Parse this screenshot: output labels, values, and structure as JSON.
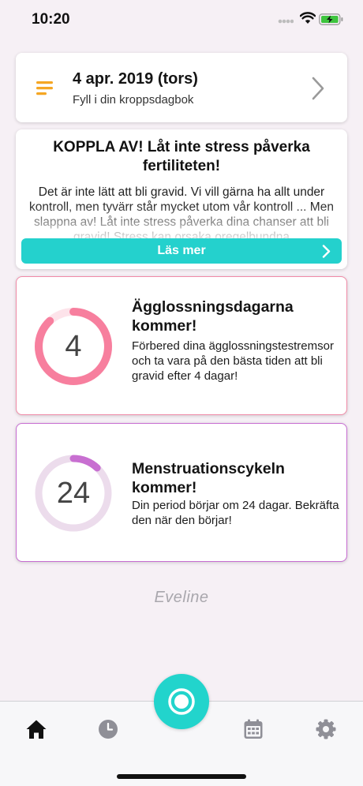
{
  "status_bar": {
    "time": "10:20"
  },
  "diary_card": {
    "date": "4 apr. 2019 (tors)",
    "subtitle": "Fyll i din kroppsdagbok",
    "menu_icon": "menu-lines-icon",
    "accent_color": "#f5a623"
  },
  "article": {
    "title": "KOPPLA AV! Låt inte stress påverka fertiliteten!",
    "body": "Det är inte lätt att bli gravid. Vi vill gärna ha allt under kontroll, men tyvärr står mycket utom vår kontroll ... Men slappna av! Låt inte stress påverka dina chanser att bli gravid! Stress kan orsaka oregelbundna",
    "read_more_label": "Läs mer",
    "button_color": "#24d1cd"
  },
  "ovulation": {
    "days": "4",
    "title": "Ägglossningsdagarna kommer!",
    "text": "Förbered dina ägglossningstestremsor och ta vara på den bästa tiden att bli gravid efter 4 dagar!",
    "ring_color": "#f77f9e",
    "progress": 0.88
  },
  "menstruation": {
    "days": "24",
    "title": "Menstruationscykeln kommer!",
    "text": "Din period börjar om 24 dagar. Bekräfta den när den börjar!",
    "ring_color": "#c86fd1",
    "progress": 0.12
  },
  "footer": {
    "logo": "Eveline"
  },
  "tabbar": {
    "tabs": [
      "home-icon",
      "clock-icon",
      "record-icon",
      "calendar-icon",
      "gear-icon"
    ],
    "active": "home-icon"
  }
}
